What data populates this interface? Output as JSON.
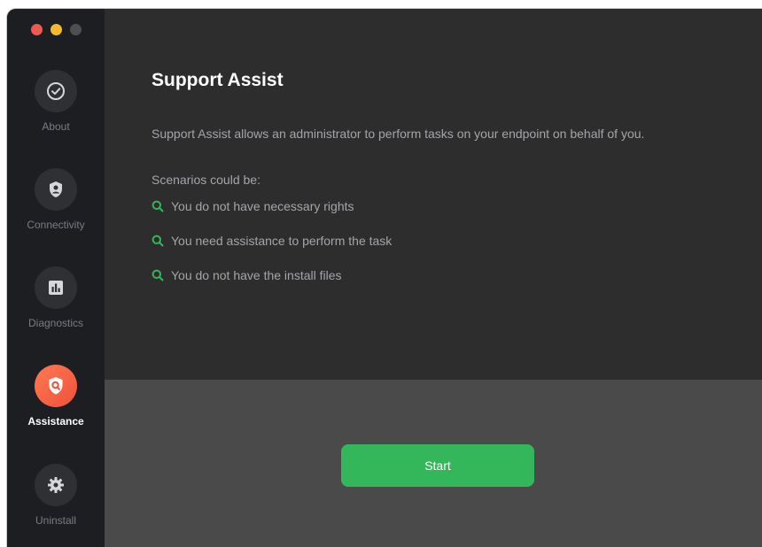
{
  "sidebar": {
    "items": [
      {
        "label": "About",
        "icon": "check-circle-icon"
      },
      {
        "label": "Connectivity",
        "icon": "shield-icon"
      },
      {
        "label": "Diagnostics",
        "icon": "chart-icon"
      },
      {
        "label": "Assistance",
        "icon": "search-shield-icon",
        "active": true
      },
      {
        "label": "Uninstall",
        "icon": "gear-icon"
      }
    ]
  },
  "main": {
    "title": "Support Assist",
    "description": "Support Assist allows an administrator to perform tasks on your endpoint on behalf of you.",
    "scenarios_title": "Scenarios could be:",
    "scenarios": [
      "You do not have necessary rights",
      "You need assistance to perform the task",
      "You do not have the install files"
    ],
    "start_label": "Start"
  },
  "colors": {
    "accent_green": "#34b65a",
    "active_orange": "#f0503b",
    "sidebar_bg": "#1d1e22"
  }
}
